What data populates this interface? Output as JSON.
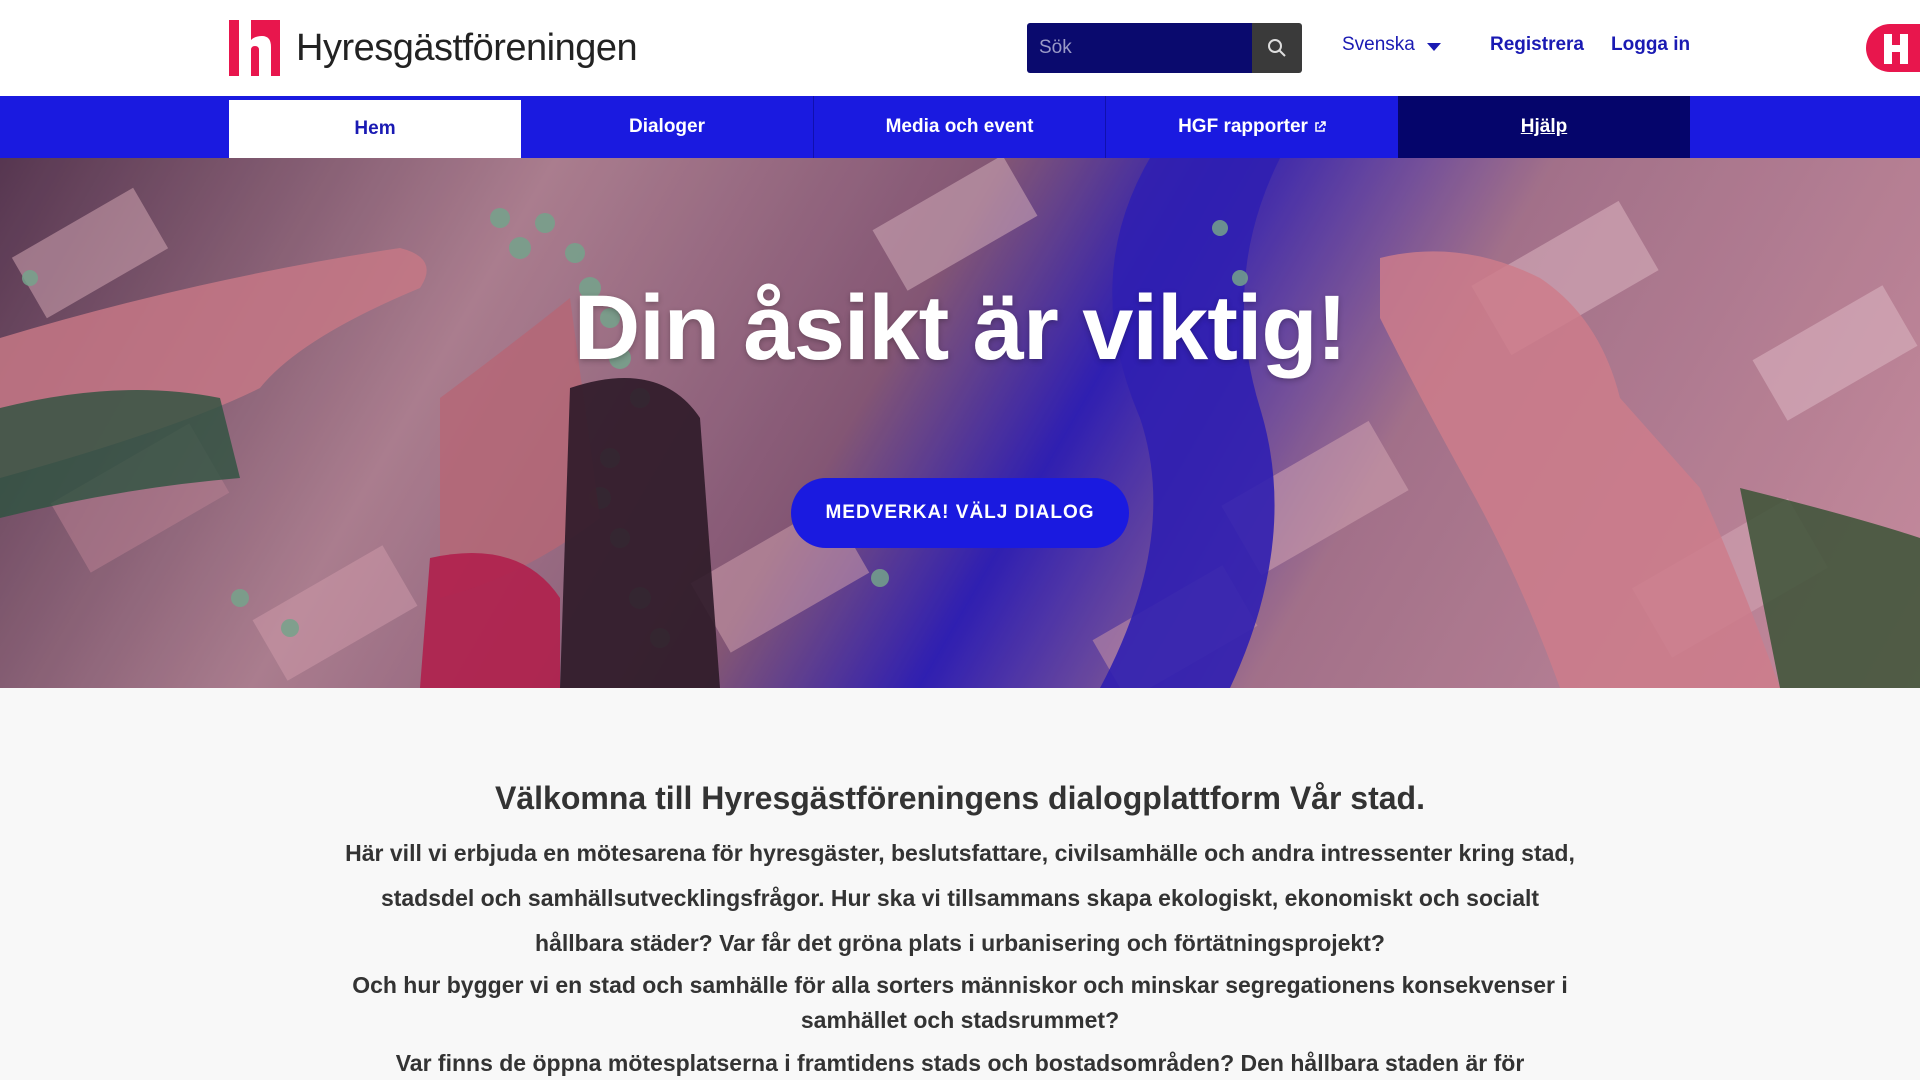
{
  "header": {
    "logo_text": "Hyresgästföreningen",
    "search_placeholder": "Sök",
    "language": "Svenska",
    "register": "Registrera",
    "login": "Logga in"
  },
  "nav": {
    "tabs": [
      {
        "label": "Hem"
      },
      {
        "label": "Dialoger"
      },
      {
        "label": "Media och event"
      },
      {
        "label": "HGF rapporter"
      },
      {
        "label": "Hjälp"
      }
    ]
  },
  "hero": {
    "title": "Din åsikt är viktig!",
    "cta": "MEDVERKA! VÄLJ DIALOG"
  },
  "content": {
    "heading": "Välkomna till Hyresgästföreningens dialogplattform Vår stad.",
    "paragraph1": "Här vill vi erbjuda en mötesarena för hyresgäster, beslutsfattare, civilsamhälle och andra intressenter kring stad, stadsdel och samhällsutvecklingsfrågor. Hur ska vi tillsammans skapa ekologiskt, ekonomiskt och socialt hållbara städer? Var får det gröna plats i urbanisering och förtätningsprojekt?",
    "paragraph2": "Och hur bygger vi en stad och samhälle för alla sorters människor och minskar segregationens konsekvenser i samhället och stadsrummet?",
    "paragraph3": "Var finns de öppna mötesplatserna i framtidens stads och bostadsområden? Den hållbara staden är för"
  },
  "colors": {
    "brand_blue": "#1a1ae0",
    "brand_red": "#e8164d",
    "dark_navy": "#05056b"
  }
}
